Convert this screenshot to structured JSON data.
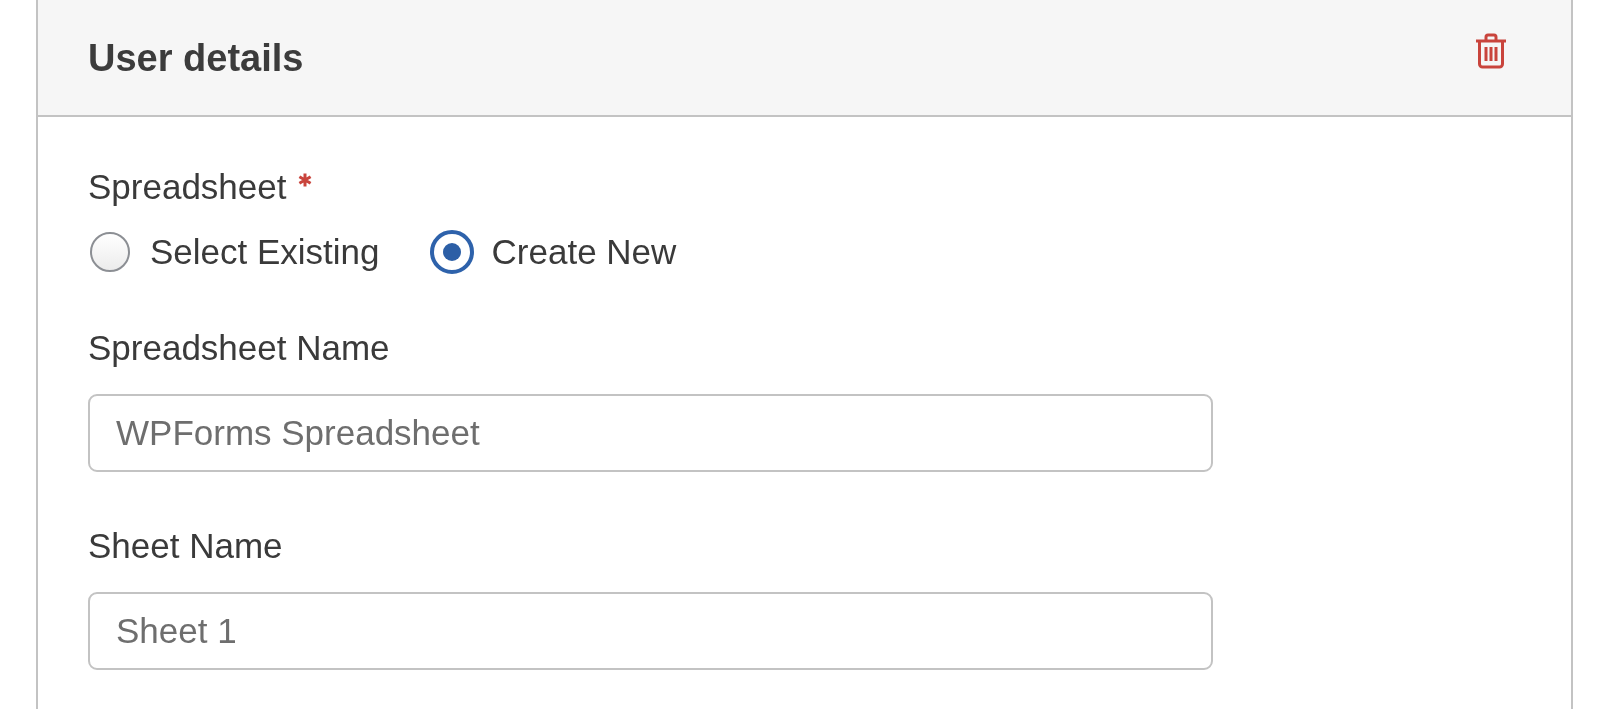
{
  "panel": {
    "title": "User details"
  },
  "spreadsheet": {
    "label": "Spreadsheet",
    "required": true,
    "options": [
      {
        "label": "Select Existing",
        "selected": false
      },
      {
        "label": "Create New",
        "selected": true
      }
    ]
  },
  "fields": [
    {
      "label": "Spreadsheet Name",
      "placeholder": "WPForms Spreadsheet"
    },
    {
      "label": "Sheet Name",
      "placeholder": "Sheet 1"
    }
  ]
}
